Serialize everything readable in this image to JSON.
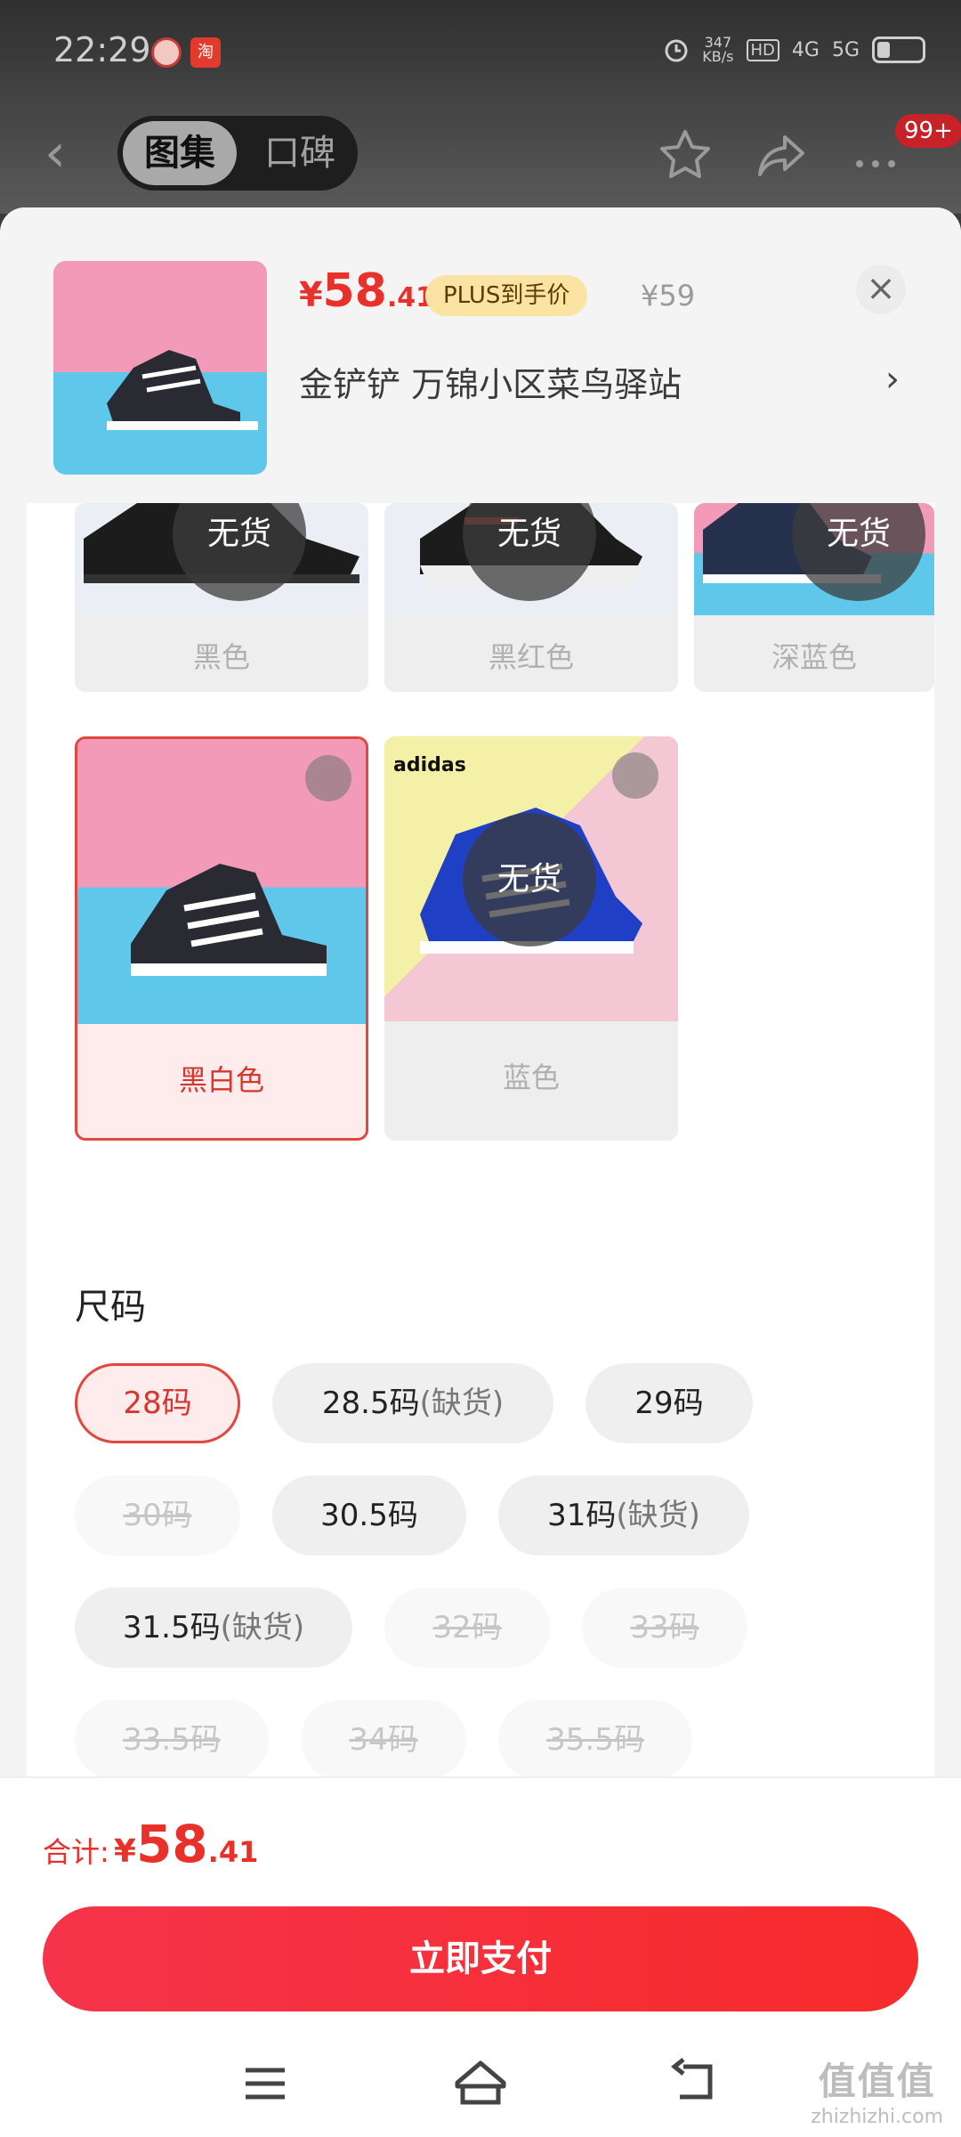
{
  "status": {
    "time": "22:29",
    "speed_val": "347",
    "speed_unit": "KB/s",
    "hd": "HD",
    "net1": "4G",
    "net2": "5G"
  },
  "nav": {
    "tab_gallery": "图集",
    "tab_reviews": "口碑",
    "badge": "99+"
  },
  "product": {
    "currency": "¥",
    "price_int": "58",
    "price_dec": ".41",
    "plus_label": "PLUS到手价",
    "original_price": "¥59",
    "delivery": "金铲铲  万锦小区菜鸟驿站"
  },
  "colors": {
    "row1": [
      {
        "label": "黑色",
        "status": "无货"
      },
      {
        "label": "黑红色",
        "status": "无货"
      },
      {
        "label": "深蓝色",
        "status": "无货"
      }
    ],
    "row2": [
      {
        "label": "黑白色"
      },
      {
        "label": "蓝色",
        "status": "无货",
        "brand": "adidas"
      }
    ]
  },
  "size": {
    "title": "尺码",
    "options": [
      {
        "label": "28码",
        "state": "selected"
      },
      {
        "label": "28.5码",
        "suffix": "(缺货)",
        "state": "available"
      },
      {
        "label": "29码",
        "state": "available"
      },
      {
        "label": "30码",
        "state": "disabled"
      },
      {
        "label": "30.5码",
        "state": "available"
      },
      {
        "label": "31码",
        "suffix": "(缺货)",
        "state": "available"
      },
      {
        "label": "31.5码",
        "suffix": "(缺货)",
        "state": "available"
      },
      {
        "label": "32码",
        "state": "disabled"
      },
      {
        "label": "33码",
        "state": "disabled"
      },
      {
        "label": "33.5码",
        "state": "disabled"
      },
      {
        "label": "34码",
        "state": "disabled"
      },
      {
        "label": "35.5码",
        "state": "disabled"
      }
    ]
  },
  "footer": {
    "total_label": "合计:",
    "currency": "¥",
    "total_int": "58",
    "total_dec": ".41",
    "pay_button": "立即支付"
  },
  "watermark": {
    "big": "值值值",
    "small": "zhizhizhi.com"
  },
  "accent": "#e8312a"
}
